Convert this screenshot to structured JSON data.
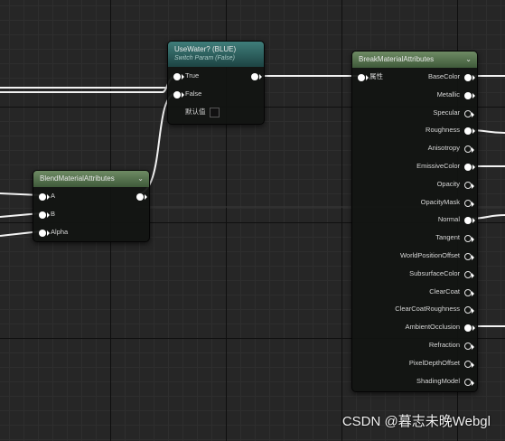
{
  "usewater_node": {
    "title": "UseWater? (BLUE)",
    "subtitle": "Switch Param (False)",
    "pins": {
      "true_label": "True",
      "false_label": "False",
      "default_label": "默认值"
    }
  },
  "blend_node": {
    "title": "BlendMaterialAttributes",
    "pins": {
      "a": "A",
      "b": "B",
      "alpha": "Alpha"
    }
  },
  "break_node": {
    "title": "BreakMaterialAttributes",
    "input_label": "属性",
    "outputs": [
      {
        "label": "BaseColor",
        "connected": true
      },
      {
        "label": "Metallic",
        "connected": true
      },
      {
        "label": "Specular",
        "connected": false
      },
      {
        "label": "Roughness",
        "connected": true
      },
      {
        "label": "Anisotropy",
        "connected": false
      },
      {
        "label": "EmissiveColor",
        "connected": true
      },
      {
        "label": "Opacity",
        "connected": false
      },
      {
        "label": "OpacityMask",
        "connected": false
      },
      {
        "label": "Normal",
        "connected": true
      },
      {
        "label": "Tangent",
        "connected": false
      },
      {
        "label": "WorldPositionOffset",
        "connected": false
      },
      {
        "label": "SubsurfaceColor",
        "connected": false
      },
      {
        "label": "ClearCoat",
        "connected": false
      },
      {
        "label": "ClearCoatRoughness",
        "connected": false
      },
      {
        "label": "AmbientOcclusion",
        "connected": true
      },
      {
        "label": "Refraction",
        "connected": false
      },
      {
        "label": "PixelDepthOffset",
        "connected": false
      },
      {
        "label": "ShadingModel",
        "connected": false
      }
    ]
  },
  "watermark": "CSDN @暮志未晚Webgl",
  "icons": {
    "collapse": "chevron-down-icon"
  }
}
